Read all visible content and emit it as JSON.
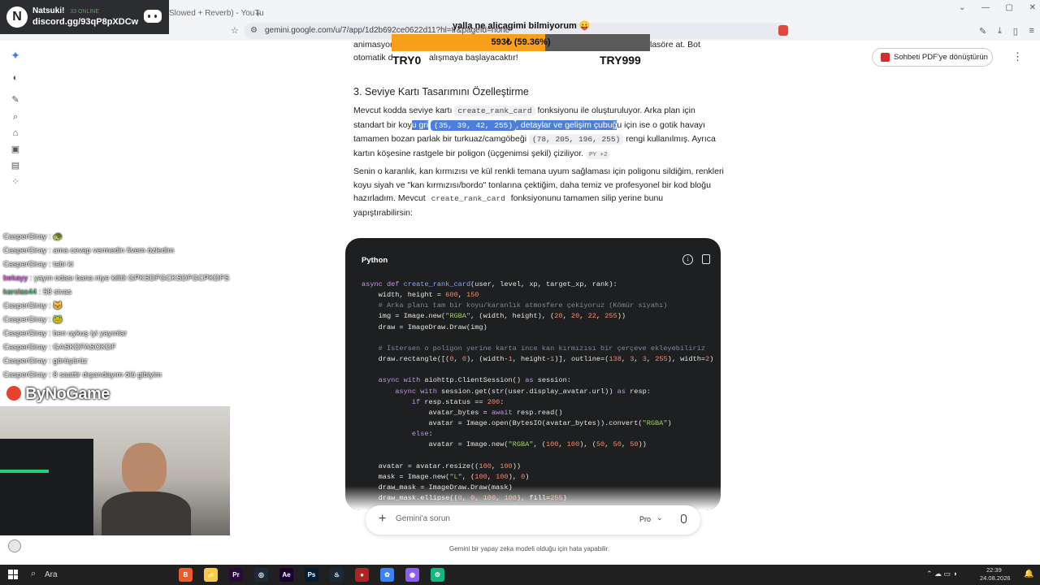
{
  "browser": {
    "tab_text": "Slowed + Reverb) - YouTu",
    "new_tab_symbol": "+",
    "url": "gemini.google.com/u/7/app/1d2b692ce0622d11?hl=tr&pageId=none",
    "window_controls": [
      "⌄",
      "—",
      "▢",
      "✕"
    ]
  },
  "discord_overlay": {
    "logo_letter": "N",
    "name": "Natsuki!",
    "online": "33 ONLINE",
    "invite": "discord.gg/93qP8pXDCw"
  },
  "donation_overlay": {
    "title": "yalla ne alicagimi bilmiyorum 😛",
    "progress_label": "593₺ (59.36%)",
    "progress_fraction": 0.5936,
    "min_label": "TRY0",
    "max_label": "TRY999",
    "fill_color": "#f9a01b"
  },
  "header": {
    "pdf_button": "Sohbeti PDF'ye dönüştürün",
    "more_icon": "more-vert-icon"
  },
  "content": {
    "top_fragment_1a": "animasyon",
    "top_fragment_1b": "lasöre at. Bot",
    "top_fragment_2a": "otomatik d",
    "top_fragment_2b": "alışmaya başlayacaktır!",
    "heading": "3. Seviye Kartı Tasarımını Özelleştirme",
    "para1": {
      "t1": "Mevcut kodda seviye kartı",
      "c1": "create_rank_card",
      "t2": "fonksiyonu ile oluşturuluyor. Arka plan için",
      "t3": "standart bir koy",
      "h1": "u gri",
      "c2": "(35, 39, 42, 255)",
      "h2": ", detaylar ve gelişim çubuğ",
      "t4": "u için ise o gotik havayı",
      "t5": "tamamen bozan parlak bir turkuaz/camgöbeği",
      "c3": "(78, 205, 196, 255)",
      "t6": "rengi kullanılmış. Ayrıca",
      "t7": "kartın köşesine rastgele bir poligon (üçgenimsi şekil) çiziliyor.",
      "badge": "PY +2"
    },
    "para2": {
      "l1": "Senin o karanlık, kan kırmızısı ve kül renkli temana uyum sağlaması için poligonu sildiğim, renkleri",
      "l2": "koyu siyah ve \"kan kırmızısı/bordo\" tonlarına çektiğim, daha temiz ve profesyonel bir kod bloğu",
      "l3a": "hazırladım. Mevcut",
      "l3c": "create_rank_card",
      "l3b": "fonksiyonunu tamamen silip yerine bunu",
      "l4": "yapıştırabilirsin:"
    }
  },
  "code_block": {
    "language": "Python",
    "lines": [
      "async def create_rank_card(user, level, xp, target_xp, rank):",
      "    width, height = 600, 150",
      "    # Arka planı tam bir koyu/karanlık atmosfere çekiyoruz (Kömür siyahı)",
      "    img = Image.new(\"RGBA\", (width, height), (20, 20, 22, 255))",
      "    draw = ImageDraw.Draw(img)",
      "",
      "    # İstersen o poligon yerine karta ince kan kırmızısı bir çerçeve ekleyebiliriz",
      "    draw.rectangle([(0, 0), (width-1, height-1)], outline=(138, 3, 3, 255), width=2)",
      "",
      "    async with aiohttp.ClientSession() as session:",
      "        async with session.get(str(user.display_avatar.url)) as resp:",
      "            if resp.status == 200:",
      "                avatar_bytes = await resp.read()",
      "                avatar = Image.open(BytesIO(avatar_bytes)).convert(\"RGBA\")",
      "            else:",
      "                avatar = Image.new(\"RGBA\", (100, 100), (50, 50, 50))",
      "",
      "    avatar = avatar.resize((100, 100))",
      "    mask = Image.new(\"L\", (100, 100), 0)",
      "    draw_mask = ImageDraw.Draw(mask)",
      "    draw_mask.ellipse((0, 0, 100, 100), fill=255)"
    ]
  },
  "prompt": {
    "placeholder": "Gemini'a sorun",
    "model": "Pro",
    "disclaimer": "Gemini bir yapay zeka modeli olduğu için hata yapabilir."
  },
  "chat": [
    {
      "user": "CasperGiray",
      "msg": "🐢"
    },
    {
      "user": "CasperGiray",
      "msg": "ama cevap vermedin fivem özledim"
    },
    {
      "user": "CasperGiray",
      "msg": "tabi ki"
    },
    {
      "user": "bekayy",
      "msg": "yayın odası bana niye kilitli GPKSDFGCKSDFGCPKDFS"
    },
    {
      "user": "karolas44",
      "msg": "58 sivas"
    },
    {
      "user": "CasperGiray",
      "msg": "🐱"
    },
    {
      "user": "CasperGiray",
      "msg": "🐸"
    },
    {
      "user": "CasperGiray",
      "msg": "ben uykuş iyi yayınlar"
    },
    {
      "user": "CasperGiray",
      "msg": "GASKDFASOKDF"
    },
    {
      "user": "CasperGiray",
      "msg": "görüşürüz"
    },
    {
      "user": "CasperGiray",
      "msg": "8 saattir dışarıdayım ölü gibiyim"
    }
  ],
  "sponsor": "ByNoGame",
  "taskbar": {
    "search": "Ara",
    "time": "22:39",
    "date": "24.08.2026",
    "apps": [
      "B",
      "📁",
      "Pr",
      "◎",
      "Ae",
      "Ps",
      "♨",
      "●",
      "✿",
      "◉",
      "⚙"
    ]
  }
}
